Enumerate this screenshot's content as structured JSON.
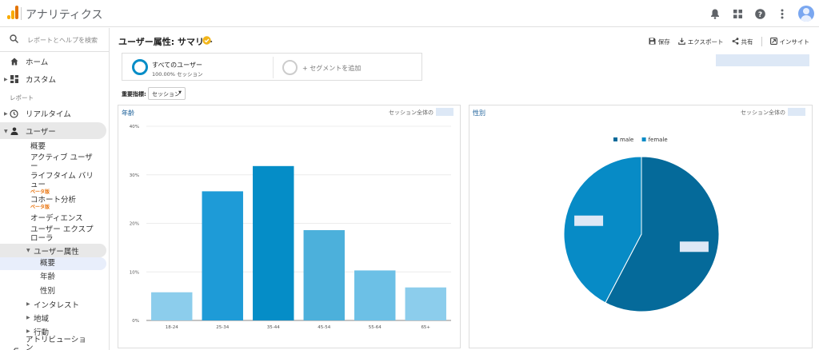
{
  "app": {
    "title": "アナリティクス"
  },
  "topbar": {
    "icons": [
      "bell-icon",
      "apps-grid-icon",
      "help-icon",
      "more-vert-icon",
      "account-avatar"
    ]
  },
  "sidebar": {
    "search_placeholder": "レポートとヘルプを検索",
    "home": "ホーム",
    "custom": "カスタム",
    "reports_section": "レポート",
    "realtime": "リアルタイム",
    "user": "ユーザー",
    "user_sub": {
      "overview": "概要",
      "active_users_1": "アクティブ ユーザ",
      "active_users_2": "ー",
      "lifetime_1": "ライフタイム バリ",
      "lifetime_2": "ュー",
      "lifetime_beta": "ベータ版",
      "cohort": "コホート分析",
      "cohort_beta": "ベータ版",
      "audience": "オーディエンス",
      "explorer_1": "ユーザー エクスプ",
      "explorer_2": "ローラ",
      "demographics": "ユーザー属性",
      "demo_overview": "概要",
      "demo_age": "年齢",
      "demo_gender": "性別",
      "interests": "インタレスト",
      "geo": "地域",
      "behavior": "行動",
      "attribution_1": "アトリビューショ",
      "attribution_2": "ン"
    }
  },
  "main": {
    "title": "ユーザー属性: サマリー",
    "actions": {
      "save": "保存",
      "export": "エクスポート",
      "share": "共有",
      "insight": "インサイト"
    },
    "segment": {
      "name": "すべてのユーザー",
      "sub": "100.00% セッション",
      "add": "+ セグメントを追加"
    },
    "metric": {
      "label": "重要指標:",
      "selected": "セッション"
    }
  },
  "age_card": {
    "title": "年齢",
    "note": "セッション全体の"
  },
  "gender_card": {
    "title": "性別",
    "note": "セッション全体の"
  },
  "colors": {
    "accent": "#058dc7",
    "primary_text": "#1a5f99",
    "placeholder": "#dde8f6"
  },
  "chart_data": [
    {
      "type": "bar",
      "title": "年齢",
      "categories": [
        "18-24",
        "25-34",
        "35-44",
        "45-54",
        "55-64",
        "65+"
      ],
      "values": [
        5.8,
        26.6,
        31.8,
        18.6,
        10.3,
        6.8
      ],
      "ylim": [
        0,
        40
      ],
      "yticks": [
        "0%",
        "10%",
        "20%",
        "30%",
        "40%"
      ],
      "ytick_values": [
        0,
        10,
        20,
        30,
        40
      ],
      "colors": [
        "#8ccdec",
        "#1e9bd7",
        "#058dc7",
        "#4cb0db",
        "#6cc0e6",
        "#8ccdec"
      ],
      "grid": true
    },
    {
      "type": "pie",
      "title": "性別",
      "labels": [
        "male",
        "female"
      ],
      "values": [
        57.7,
        42.3
      ],
      "colors": [
        "#056a9a",
        "#078bc6"
      ],
      "legend": "top"
    }
  ]
}
